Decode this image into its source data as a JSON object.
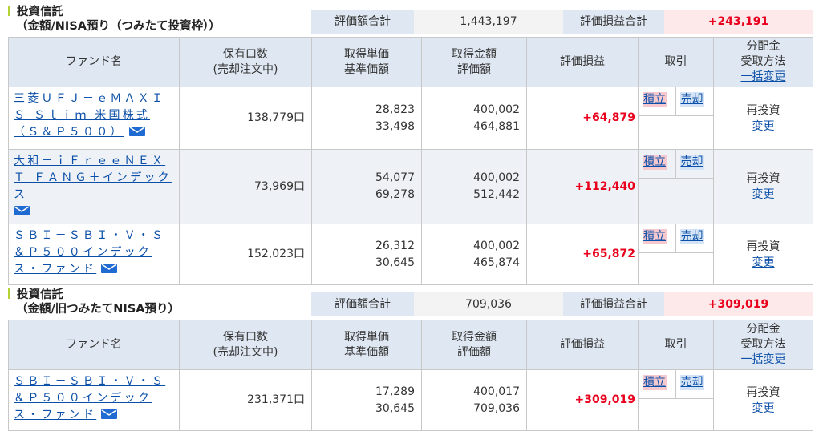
{
  "sections": [
    {
      "title_line1": "投資信託",
      "title_line2": "（金額/NISA預り（つみたて投資枠））",
      "total_label": "評価額合計",
      "total_value": "1,443,197",
      "pl_label": "評価損益合計",
      "pl_value": "+243,191",
      "headers": {
        "fund": "ファンド名",
        "units_1": "保有口数",
        "units_2": "(売却注文中)",
        "unit_price_1": "取得単価",
        "unit_price_2": "基準価額",
        "amount_1": "取得金額",
        "amount_2": "評価額",
        "pl": "評価損益",
        "trade": "取引",
        "dist_1": "分配金",
        "dist_2": "受取方法",
        "dist_3": "一括変更"
      },
      "rows": [
        {
          "fund": "三菱ＵＦＪ－ｅＭＡＸＩＳ Ｓｌｉｍ 米国株式（Ｓ＆Ｐ５００）",
          "units": "138,779口",
          "acq_price": "28,823",
          "base_price": "33,498",
          "acq_amount": "400,002",
          "eval_amount": "464,881",
          "pl": "+64,879",
          "buy": "積立",
          "sell": "売却",
          "dist": "再投資",
          "dist_change": "変更"
        },
        {
          "fund": "大和－ｉＦｒｅｅＮＥＸＴ ＦＡＮＧ＋インデックス",
          "units": "73,969口",
          "acq_price": "54,077",
          "base_price": "69,278",
          "acq_amount": "400,002",
          "eval_amount": "512,442",
          "pl": "+112,440",
          "buy": "積立",
          "sell": "売却",
          "dist": "再投資",
          "dist_change": "変更"
        },
        {
          "fund": "ＳＢＩ－ＳＢＩ・Ｖ・Ｓ＆Ｐ５００インデックス・ファンド",
          "units": "152,023口",
          "acq_price": "26,312",
          "base_price": "30,645",
          "acq_amount": "400,002",
          "eval_amount": "465,874",
          "pl": "+65,872",
          "buy": "積立",
          "sell": "売却",
          "dist": "再投資",
          "dist_change": "変更"
        }
      ]
    },
    {
      "title_line1": "投資信託",
      "title_line2": "（金額/旧つみたてNISA預り）",
      "total_label": "評価額合計",
      "total_value": "709,036",
      "pl_label": "評価損益合計",
      "pl_value": "+309,019",
      "headers": {
        "fund": "ファンド名",
        "units_1": "保有口数",
        "units_2": "(売却注文中)",
        "unit_price_1": "取得単価",
        "unit_price_2": "基準価額",
        "amount_1": "取得金額",
        "amount_2": "評価額",
        "pl": "評価損益",
        "trade": "取引",
        "dist_1": "分配金",
        "dist_2": "受取方法",
        "dist_3": "一括変更"
      },
      "rows": [
        {
          "fund": "ＳＢＩ－ＳＢＩ・Ｖ・Ｓ＆Ｐ５００インデックス・ファンド",
          "units": "231,371口",
          "acq_price": "17,289",
          "base_price": "30,645",
          "acq_amount": "400,017",
          "eval_amount": "709,036",
          "pl": "+309,019",
          "buy": "積立",
          "sell": "売却",
          "dist": "再投資",
          "dist_change": "変更"
        }
      ]
    }
  ],
  "icons": {
    "mail": "mail-icon"
  },
  "colors": {
    "profit": "#e8001c",
    "link": "#0b50a8",
    "header_bg": "#dfe7f2",
    "accent_bar": "#b5d335"
  }
}
